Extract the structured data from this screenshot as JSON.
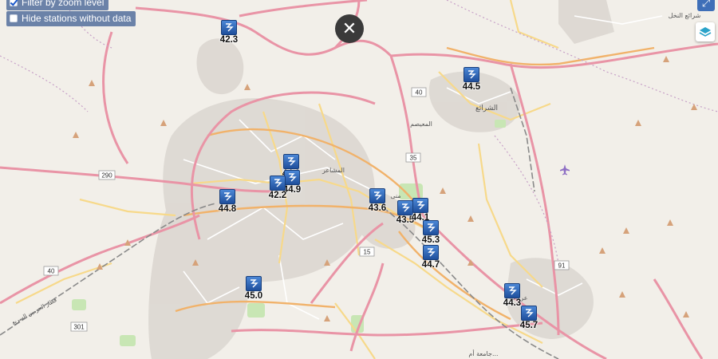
{
  "controls": {
    "filter_label": "Filter by zoom level",
    "filter_checked": true,
    "hide_label": "Hide stations without data",
    "hide_checked": false,
    "close_glyph": "✕",
    "expand_glyph": "⤢"
  },
  "map_labels": {
    "shara_ia": "الشرائع",
    "shara_ia_alnakhl": "شرائع النخل",
    "al_muaisem": "المعيصم",
    "mina": "منى",
    "al_mashaer": "المشاعر",
    "arafat": "عرفات",
    "um_al_qura": "جامعة أم...",
    "haramain": "قطار الحرمين السريع"
  },
  "road_shields": [
    "290",
    "40",
    "40",
    "35",
    "15",
    "91",
    "301"
  ],
  "stations": [
    {
      "id": "s1",
      "value": "42.3"
    },
    {
      "id": "s2",
      "value": "44.5"
    },
    {
      "id": "s3",
      "value": "44.0"
    },
    {
      "id": "s4",
      "value": "44.9"
    },
    {
      "id": "s5",
      "value": "42.2"
    },
    {
      "id": "s6",
      "value": "44.8"
    },
    {
      "id": "s7",
      "value": "43.6"
    },
    {
      "id": "s8",
      "value": "43.5"
    },
    {
      "id": "s9",
      "value": "44.1"
    },
    {
      "id": "s10",
      "value": "45.3"
    },
    {
      "id": "s11",
      "value": "44.7"
    },
    {
      "id": "s12",
      "value": "45.0"
    },
    {
      "id": "s13",
      "value": "44.3"
    },
    {
      "id": "s14",
      "value": "45.7"
    }
  ]
}
